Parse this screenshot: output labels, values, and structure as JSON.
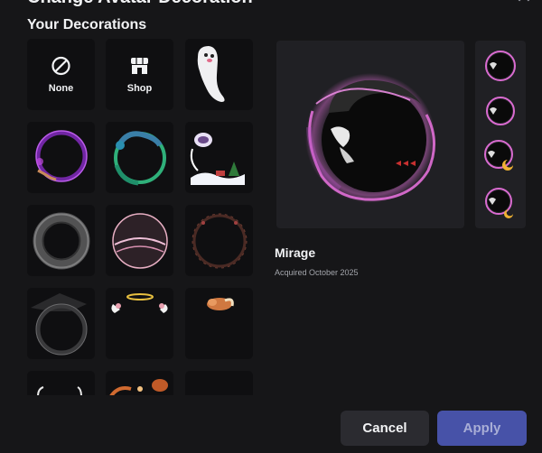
{
  "modal": {
    "title": "Change Avatar Decoration",
    "close_icon": "close-icon"
  },
  "section_label": "Your Decorations",
  "tiles": [
    {
      "label": "None",
      "icon": "no-decoration-icon"
    },
    {
      "label": "Shop",
      "icon": "shop-icon"
    },
    {
      "name": "ghost"
    },
    {
      "name": "purple-flame-ring"
    },
    {
      "name": "serpent-ring"
    },
    {
      "name": "winter-scene"
    },
    {
      "name": "smoke-ring"
    },
    {
      "name": "pink-bubble"
    },
    {
      "name": "thorn-ring"
    },
    {
      "name": "dark-hat-ring"
    },
    {
      "name": "angel-halo"
    },
    {
      "name": "sleeping-fox"
    },
    {
      "name": "partial-1"
    },
    {
      "name": "partial-2"
    },
    {
      "name": "partial-3"
    }
  ],
  "selected": {
    "name": "Mirage",
    "acquired": "Acquired October 2025"
  },
  "buttons": {
    "cancel": "Cancel",
    "apply": "Apply"
  },
  "colors": {
    "background": "#161618",
    "tile": "#0f0f11",
    "preview": "#202024",
    "apply": "#4752a8",
    "accent_pink": "#d96bd0"
  }
}
